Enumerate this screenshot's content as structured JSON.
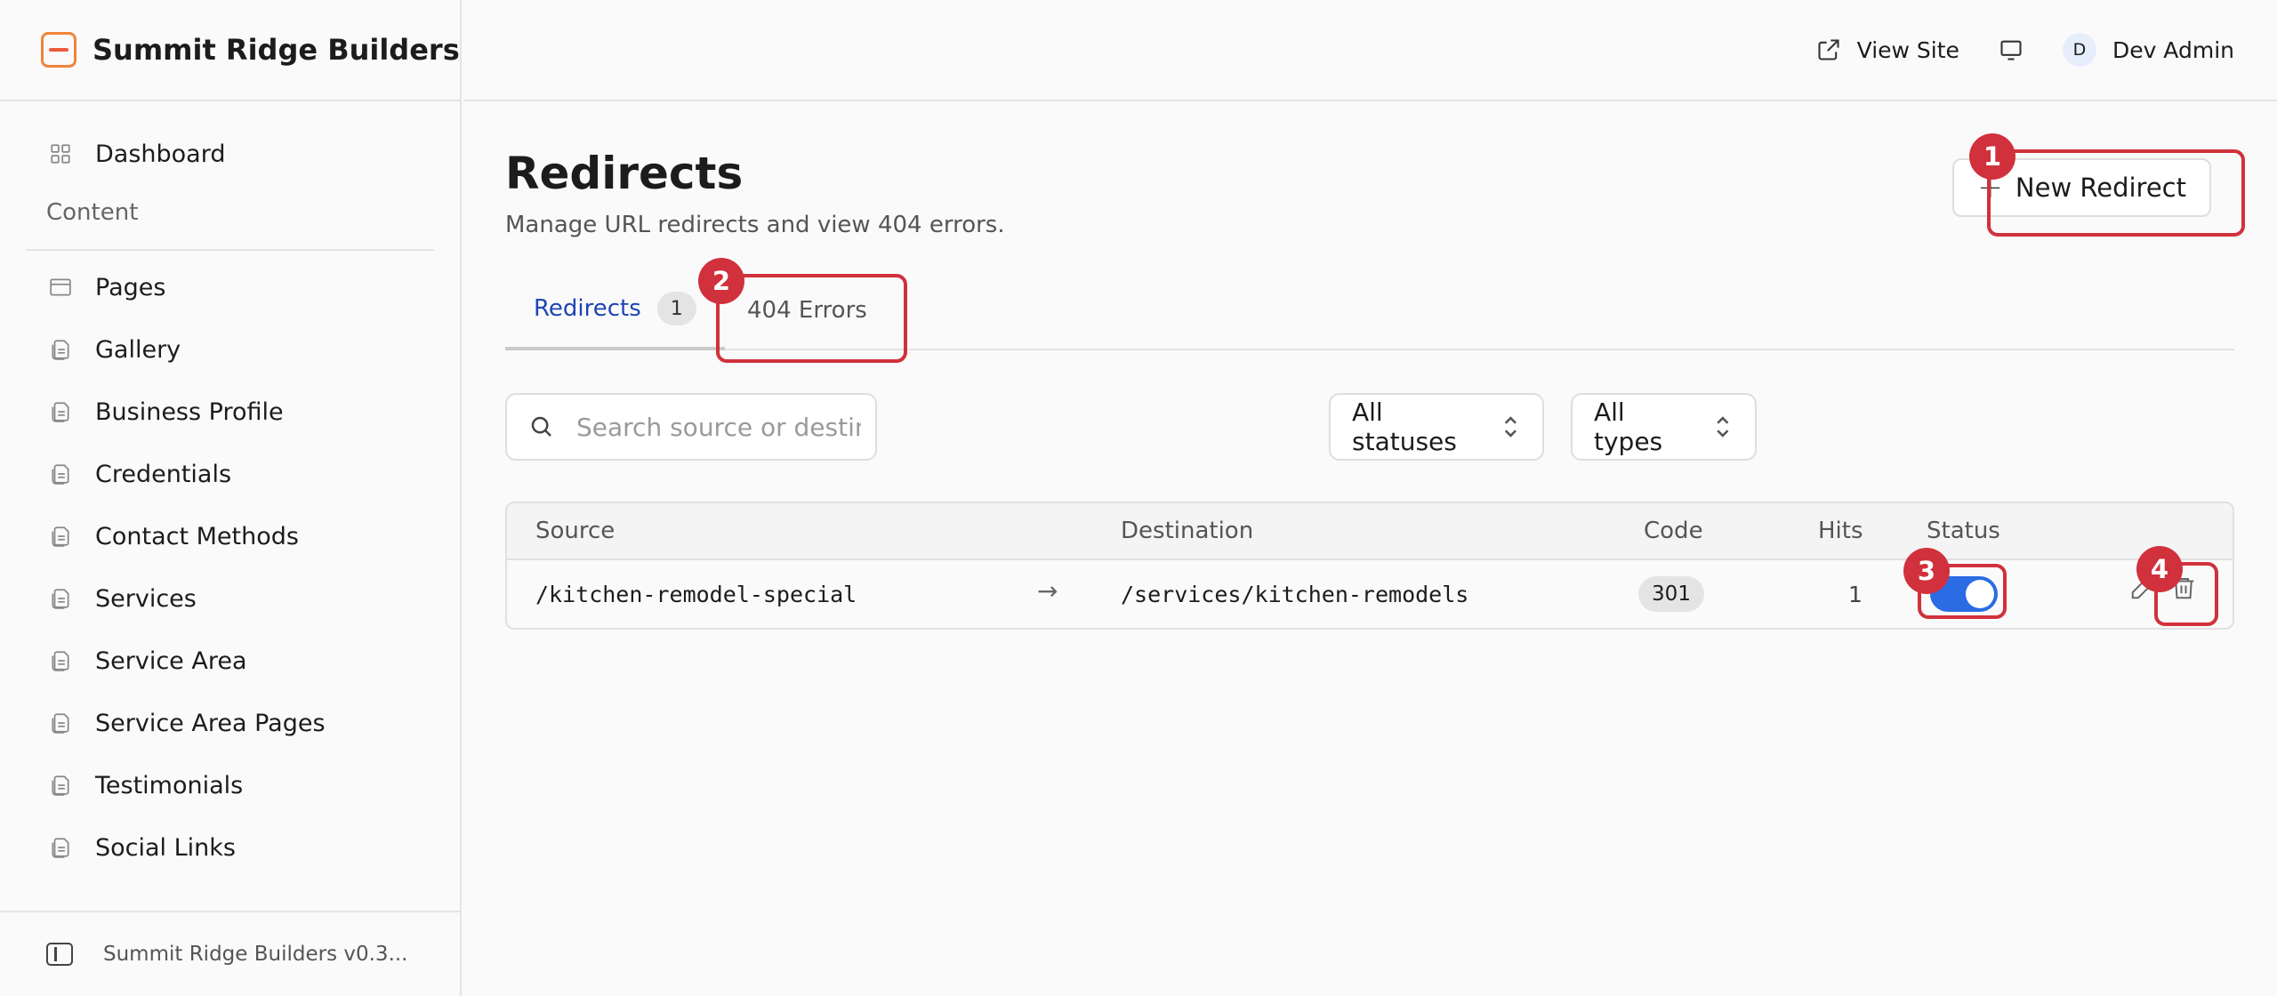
{
  "sidebar": {
    "brand_name": "Summit Ridge Builders",
    "dashboard_label": "Dashboard",
    "section_label": "Content",
    "items": [
      {
        "label": "Pages"
      },
      {
        "label": "Gallery"
      },
      {
        "label": "Business Profile"
      },
      {
        "label": "Credentials"
      },
      {
        "label": "Contact Methods"
      },
      {
        "label": "Services"
      },
      {
        "label": "Service Area"
      },
      {
        "label": "Service Area Pages"
      },
      {
        "label": "Testimonials"
      },
      {
        "label": "Social Links"
      }
    ],
    "footer_version": "Summit Ridge Builders v0.3..."
  },
  "header": {
    "view_site": "View Site",
    "avatar_initial": "D",
    "user_name": "Dev Admin"
  },
  "main": {
    "title": "Redirects",
    "subtitle": "Manage URL redirects and view 404 errors.",
    "new_button": "New Redirect",
    "tabs": [
      {
        "label": "Redirects",
        "count": "1",
        "active": true
      },
      {
        "label": "404 Errors",
        "active": false
      }
    ],
    "search_placeholder": "Search source or destination...",
    "status_filter": "All statuses",
    "type_filter": "All types",
    "table": {
      "columns": [
        "Source",
        "Destination",
        "Code",
        "Hits",
        "Status"
      ],
      "rows": [
        {
          "source": "/kitchen-remodel-special",
          "destination": "/services/kitchen-remodels",
          "code": "301",
          "hits": "1",
          "enabled": true
        }
      ]
    }
  },
  "annotations": [
    "1",
    "2",
    "3",
    "4"
  ],
  "colors": {
    "accent": "#1f45b5",
    "toggle_on": "#2b6be4",
    "annotation": "#d1313c",
    "brand_orange": "#f0843a"
  }
}
